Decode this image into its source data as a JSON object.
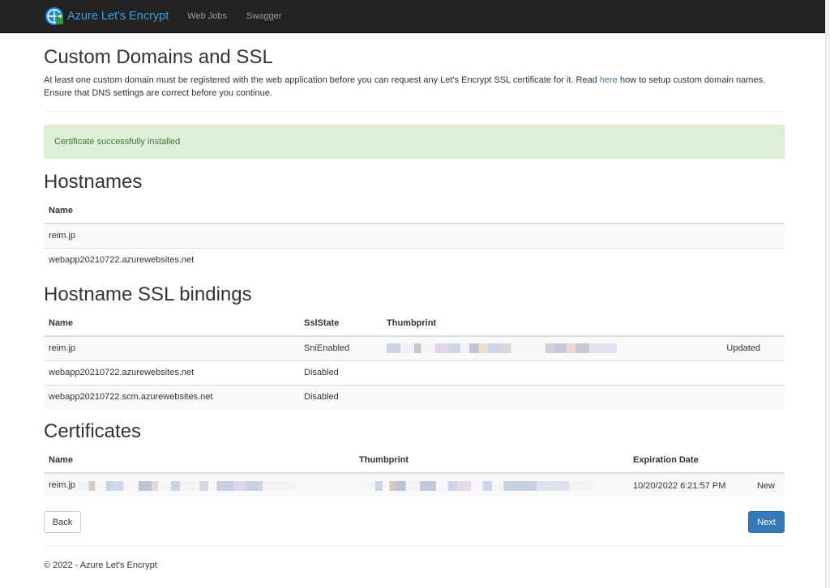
{
  "navbar": {
    "brand": "Azure Let's Encrypt",
    "links": [
      "Web Jobs",
      "Swagger"
    ]
  },
  "page": {
    "title": "Custom Domains and SSL",
    "intro_before": "At least one custom domain must be registered with the web application before you can request any Let's Encrypt SSL certificate for it. Read ",
    "intro_link": "here",
    "intro_after": " how to setup custom domain names. Ensure that DNS settings are correct before you continue."
  },
  "alert": {
    "text": "Certificate successfully installed"
  },
  "hostnames": {
    "title": "Hostnames",
    "header": "Name",
    "rows": [
      "reim.jp",
      "webapp20210722.azurewebsites.net"
    ]
  },
  "bindings": {
    "title": "Hostname SSL bindings",
    "headers": [
      "Name",
      "SslState",
      "Thumbprint"
    ],
    "rows": [
      {
        "name": "reim.jp",
        "state": "SniEnabled",
        "status": "Updated"
      },
      {
        "name": "webapp20210722.azurewebsites.net",
        "state": "Disabled",
        "status": ""
      },
      {
        "name": "webapp20210722.scm.azurewebsites.net",
        "state": "Disabled",
        "status": ""
      }
    ]
  },
  "certificates": {
    "title": "Certificates",
    "headers": [
      "Name",
      "Thumbprint",
      "Expiration Date"
    ],
    "rows": [
      {
        "name": "reim.jp",
        "expiration": "10/20/2022 6:21:57 PM",
        "status": "New"
      }
    ]
  },
  "buttons": {
    "back": "Back",
    "next": "Next"
  },
  "footer": "© 2022 - Azure Let's Encrypt",
  "colors": {
    "navbar": "#222222",
    "brand": "#3b9ee4",
    "link": "#337ab7",
    "alert_bg": "#dff0d8",
    "alert_text": "#3c763d",
    "primary": "#337ab7"
  }
}
